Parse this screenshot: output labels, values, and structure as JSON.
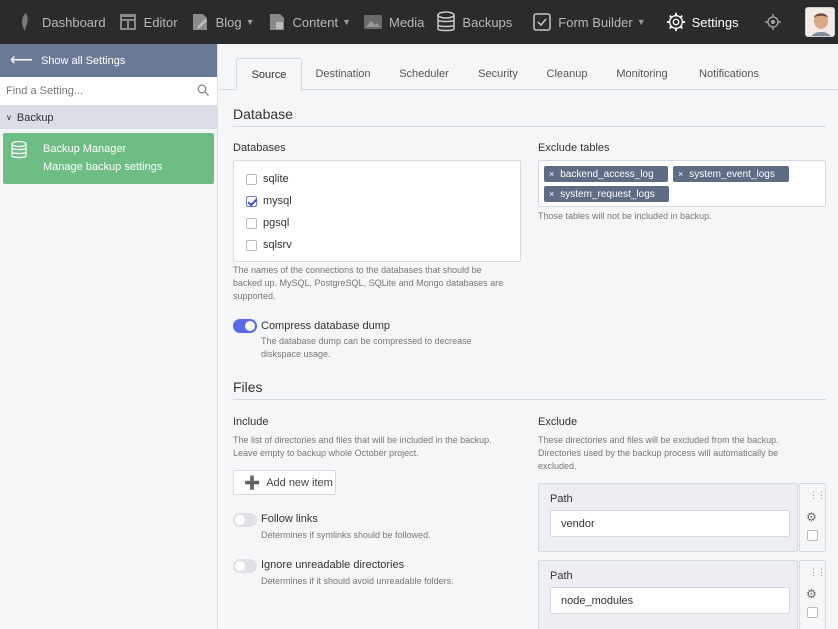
{
  "nav": {
    "items": [
      {
        "label": "Dashboard",
        "icon": "october-logo-icon",
        "has_chevron": false
      },
      {
        "label": "Editor",
        "icon": "editor-icon",
        "has_chevron": false
      },
      {
        "label": "Blog",
        "icon": "blog-icon",
        "has_chevron": true
      },
      {
        "label": "Content",
        "icon": "content-icon",
        "has_chevron": true
      },
      {
        "label": "Media",
        "icon": "media-icon",
        "has_chevron": false
      },
      {
        "label": "Backups",
        "icon": "database-icon",
        "has_chevron": false
      },
      {
        "label": "Form Builder",
        "icon": "form-builder-icon",
        "has_chevron": true
      },
      {
        "label": "Settings",
        "icon": "gear-icon",
        "has_chevron": false,
        "active": true
      }
    ]
  },
  "sidebar": {
    "show_all": "Show all Settings",
    "search_placeholder": "Find a Setting...",
    "group": "Backup",
    "item": {
      "title": "Backup Manager",
      "subtitle": "Manage backup settings"
    }
  },
  "tabs": [
    "Source",
    "Destination",
    "Scheduler",
    "Security",
    "Cleanup",
    "Monitoring",
    "Notifications"
  ],
  "database": {
    "title": "Database",
    "databases_label": "Databases",
    "options": [
      {
        "label": "sqlite",
        "checked": false
      },
      {
        "label": "mysql",
        "checked": true
      },
      {
        "label": "pgsql",
        "checked": false
      },
      {
        "label": "sqlsrv",
        "checked": false
      }
    ],
    "databases_help_1": "The names of the connections to the databases that should be",
    "databases_help_2": "backed up. MySQL, PostgreSQL, SQLite and Mongo databases are",
    "databases_help_3": "supported.",
    "exclude_label": "Exclude tables",
    "exclude_tags": [
      "backend_access_log",
      "system_event_logs",
      "system_request_logs"
    ],
    "exclude_help": "Those tables will not be included in backup.",
    "compress_label": "Compress database dump",
    "compress_on": true,
    "compress_help_1": "The database dump can be compressed to decrease",
    "compress_help_2": "diskspace usage."
  },
  "files": {
    "title": "Files",
    "include_label": "Include",
    "include_help_1": "The list of directories and files that will be included in the backup.",
    "include_help_2": "Leave empty to backup whole October project.",
    "add_item": "Add new item",
    "follow_links_label": "Follow links",
    "follow_links_help": "Determines if symlinks should be followed.",
    "ignore_label": "Ignore unreadable directories",
    "ignore_help": "Determines if it should avoid unreadable folders.",
    "exclude_label": "Exclude",
    "exclude_help_1": "These directories and files will be excluded from the backup.",
    "exclude_help_2": "Directories used by the backup process will automatically be",
    "exclude_help_3": "excluded.",
    "exclude_items": [
      {
        "label": "Path",
        "value": "vendor"
      },
      {
        "label": "Path",
        "value": "node_modules"
      }
    ]
  }
}
